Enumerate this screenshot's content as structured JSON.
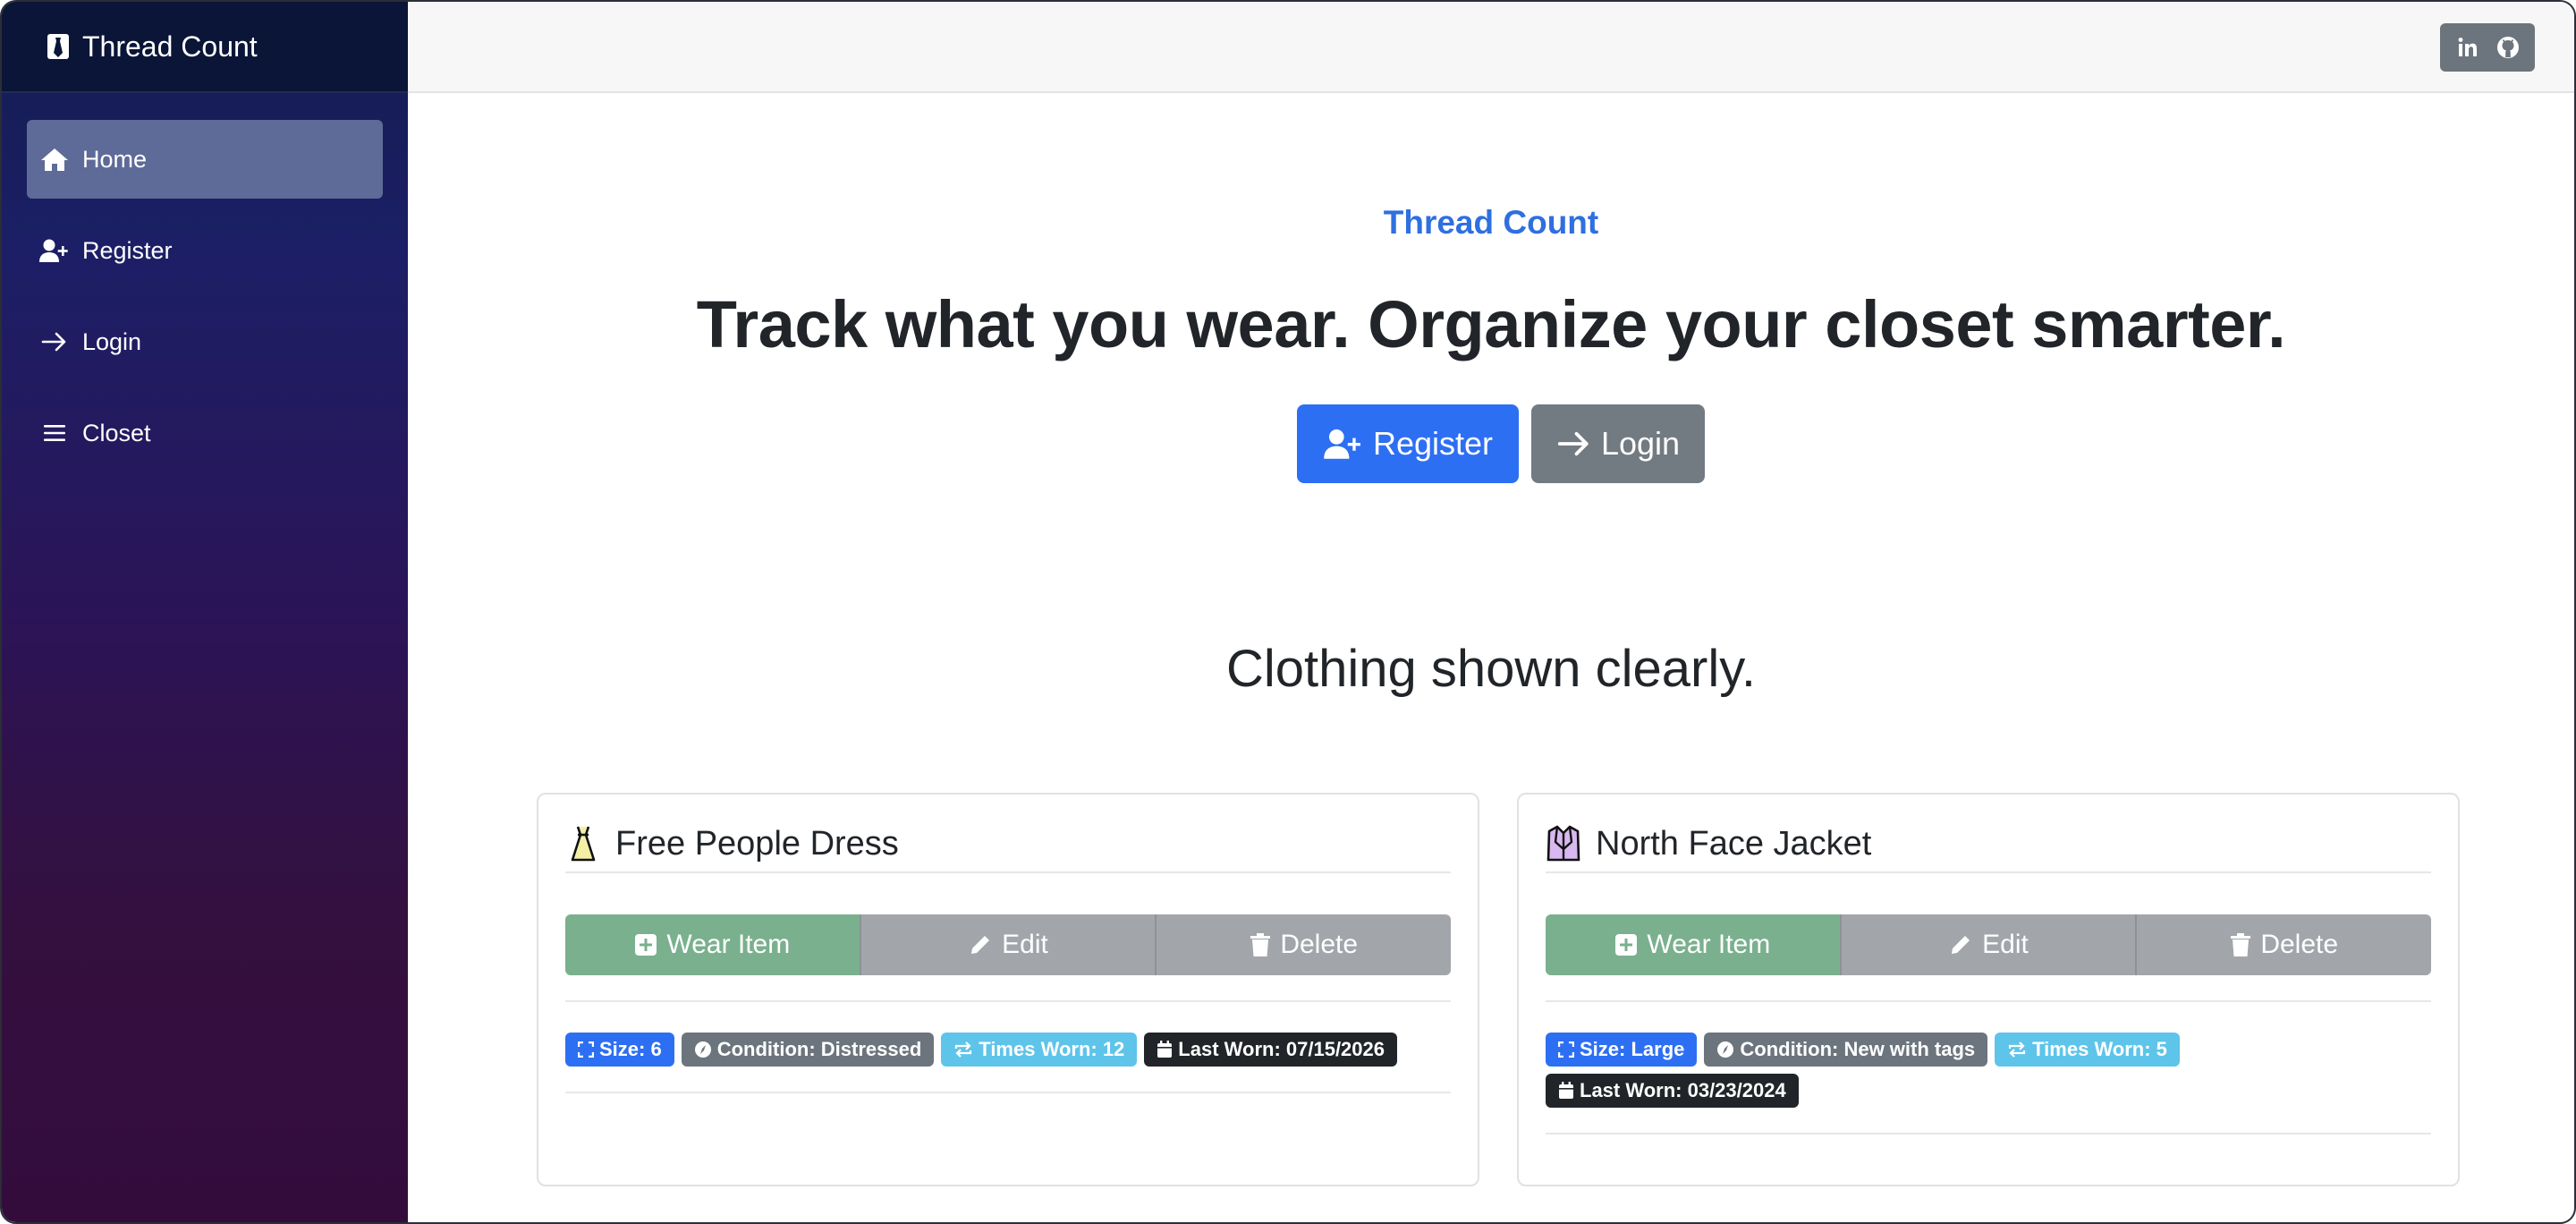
{
  "sidebar": {
    "brand": "Thread Count",
    "items": [
      {
        "label": "Home",
        "icon": "home-icon"
      },
      {
        "label": "Register",
        "icon": "user-plus-icon"
      },
      {
        "label": "Login",
        "icon": "arrow-right-icon"
      },
      {
        "label": "Closet",
        "icon": "bars-icon"
      }
    ]
  },
  "topbar": {
    "social": [
      {
        "label": "in",
        "icon": "linkedin-icon"
      },
      {
        "label": "",
        "icon": "github-icon"
      }
    ]
  },
  "hero": {
    "kicker": "Thread Count",
    "title": "Track what you wear. Organize your closet smarter.",
    "register_label": "Register",
    "login_label": "Login"
  },
  "section_title": "Clothing shown clearly.",
  "cards": [
    {
      "title": "Free People Dress",
      "icon": "dress-icon",
      "wear_label": "Wear Item",
      "edit_label": "Edit",
      "delete_label": "Delete",
      "size": "Size: 6",
      "condition": "Condition: Distressed",
      "times_worn": "Times Worn: 12",
      "last_worn": "Last Worn: 07/15/2026"
    },
    {
      "title": "North Face Jacket",
      "icon": "jacket-icon",
      "wear_label": "Wear Item",
      "edit_label": "Edit",
      "delete_label": "Delete",
      "size": "Size: Large",
      "condition": "Condition: New with tags",
      "times_worn": "Times Worn: 5",
      "last_worn": "Last Worn: 03/23/2024"
    }
  ],
  "colors": {
    "accent": "#2d6ff3",
    "wear_button": "#7ab08e",
    "badge_info": "#5ec4ea"
  }
}
